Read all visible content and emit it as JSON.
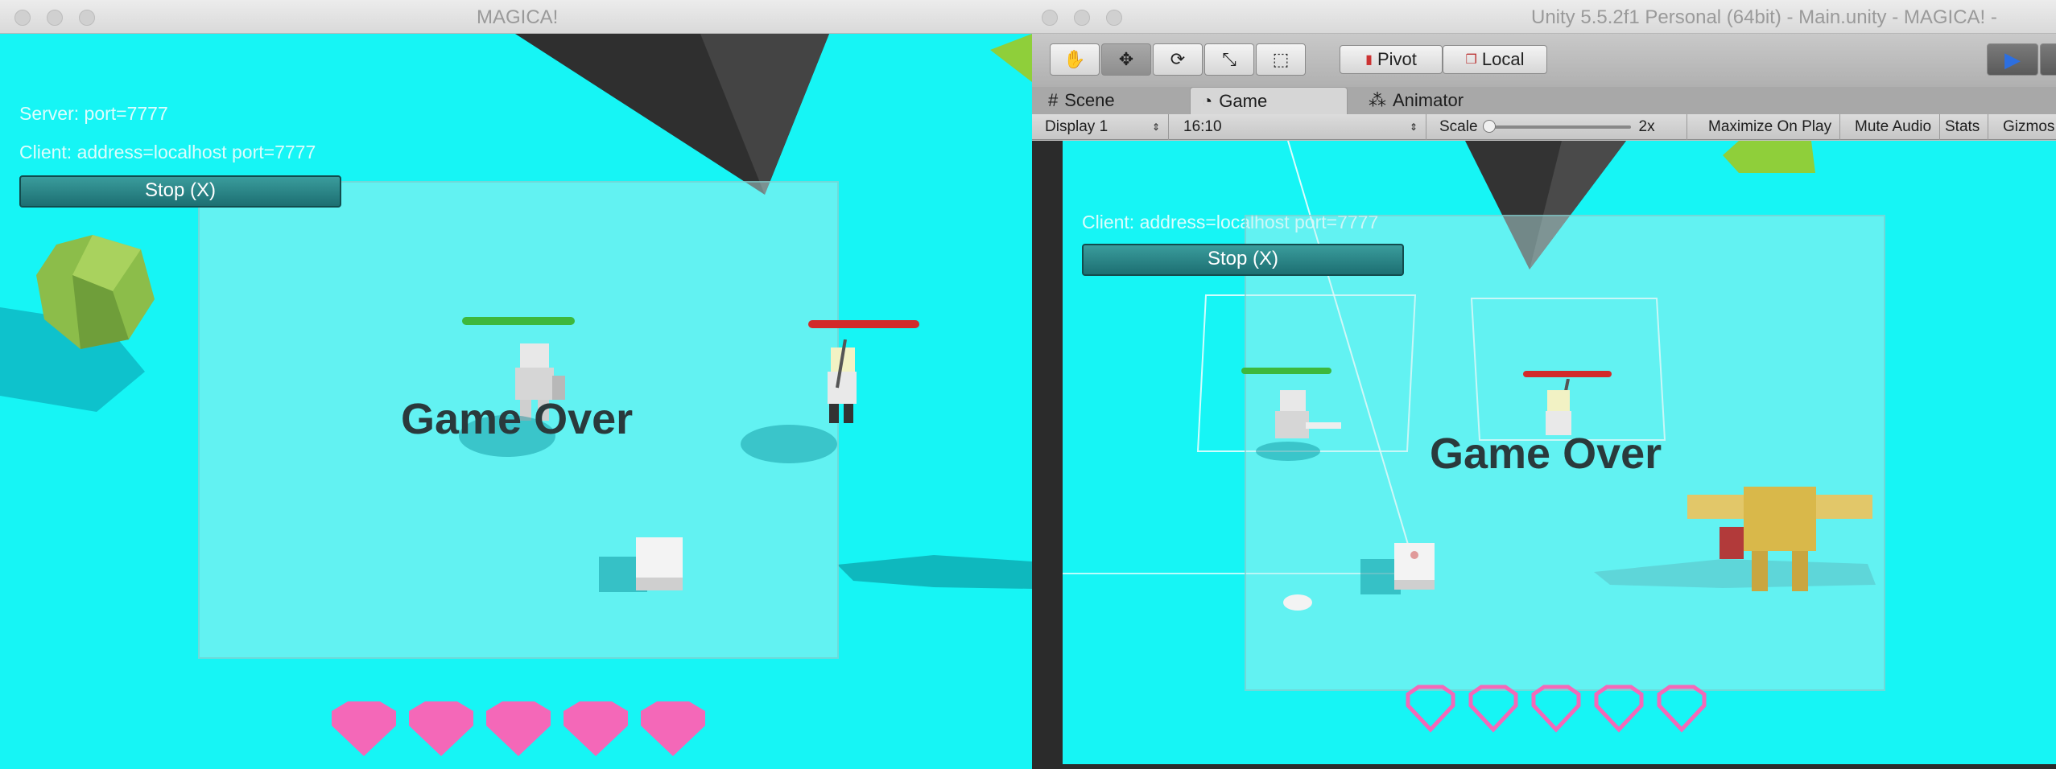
{
  "left_window": {
    "title": "MAGICA!",
    "server_text": "Server: port=7777",
    "client_text": "Client: address=localhost port=7777",
    "stop_button": "Stop (X)",
    "game_over": "Game Over",
    "hearts": 5,
    "colors": {
      "sky": "#16f5f5",
      "heart": "#f468b8"
    }
  },
  "right_window": {
    "title": "Unity 5.5.2f1 Personal (64bit) - Main.unity - MAGICA! -",
    "toolbar": {
      "pivot_label": "Pivot",
      "local_label": "Local"
    },
    "tabs": [
      {
        "label": "Scene",
        "icon": "grid-icon"
      },
      {
        "label": "Game",
        "icon": "pacman-icon"
      },
      {
        "label": "Animator",
        "icon": "nodes-icon"
      }
    ],
    "game_toolbar": {
      "display": "Display 1",
      "aspect": "16:10",
      "scale_label": "Scale",
      "scale_value": "2x",
      "maximize": "Maximize On Play",
      "mute": "Mute Audio",
      "stats": "Stats",
      "gizmos": "Gizmos"
    },
    "client_text": "Client: address=localhost port=7777",
    "stop_button": "Stop (X)",
    "game_over": "Game Over",
    "hearts": 5,
    "colors": {
      "heart_outline": "#f468b8",
      "play_accent": "#2d6fe0"
    }
  }
}
